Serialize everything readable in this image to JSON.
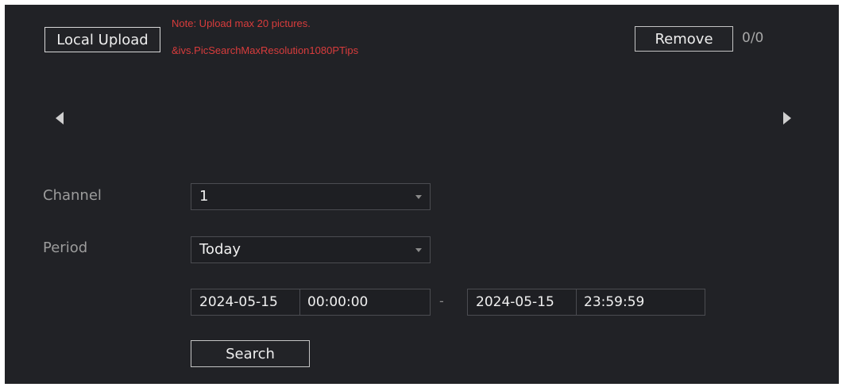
{
  "upload": {
    "button_label": "Local Upload",
    "note_line1": "Note: Upload max 20 pictures.",
    "note_line2": "&ivs.PicSearchMaxResolution1080PTips"
  },
  "remove": {
    "button_label": "Remove",
    "counter": "0/0"
  },
  "nav": {
    "prev_icon": "caret-left-icon",
    "next_icon": "caret-right-icon"
  },
  "form": {
    "channel_label": "Channel",
    "channel_value": "1",
    "period_label": "Period",
    "period_value": "Today",
    "start_date": "2024-05-15",
    "start_time": "00:00:00",
    "range_separator": "-",
    "end_date": "2024-05-15",
    "end_time": "23:59:59",
    "search_label": "Search"
  },
  "colors": {
    "background": "#212226",
    "note": "#d83c3c",
    "text": "#f0f0f0",
    "label": "#9c9c9c"
  }
}
